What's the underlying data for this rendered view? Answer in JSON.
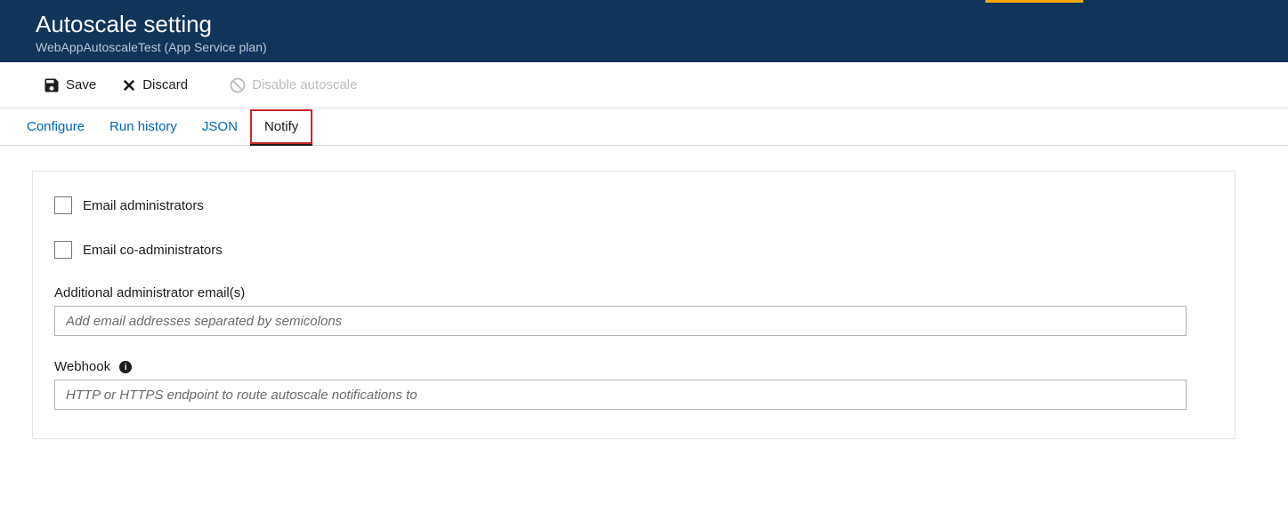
{
  "header": {
    "title": "Autoscale setting",
    "subtitle": "WebAppAutoscaleTest (App Service plan)"
  },
  "toolbar": {
    "save_label": "Save",
    "discard_label": "Discard",
    "disable_label": "Disable autoscale"
  },
  "tabs": {
    "configure": "Configure",
    "run_history": "Run history",
    "json": "JSON",
    "notify": "Notify"
  },
  "notify": {
    "email_admins_label": "Email administrators",
    "email_coadmins_label": "Email co-administrators",
    "additional_emails_label": "Additional administrator email(s)",
    "additional_emails_placeholder": "Add email addresses separated by semicolons",
    "webhook_label": "Webhook",
    "webhook_placeholder": "HTTP or HTTPS endpoint to route autoscale notifications to"
  }
}
